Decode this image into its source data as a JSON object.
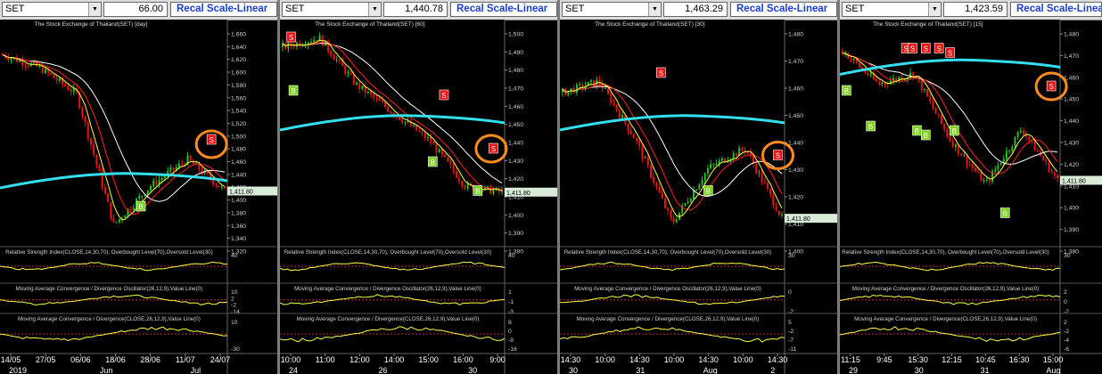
{
  "panels": [
    {
      "symbol": "SET",
      "value": "66.00",
      "recal": "Recal Scale-Linear",
      "title": "The Stock Exchange of Thailand(SET) [day]",
      "price_ticks": [
        "1,660",
        "1,640",
        "1,620",
        "1,600",
        "1,580",
        "1,560",
        "1,540",
        "1,520",
        "1,500",
        "1,480",
        "1,460",
        "1,440",
        "1,420",
        "1,400",
        "1,380",
        "1,360",
        "1,340",
        "1,320"
      ],
      "last_price": "1,411.80",
      "rsi_title": "Relative Strength Index(CLOSE,14,30,70), Overbought Level(70),Oversold Level(30)",
      "rsi_ticks": [
        "40"
      ],
      "macd1_title": "Moving Average Convergence / Divergence Oscillator(26,12,9),Value Line(0)",
      "macd1_ticks": [
        "10",
        "2",
        "-2",
        "-14"
      ],
      "macd2_title": "Moving Average Convergence / Divergence(CLOSE,26,12,9),Value Line(0)",
      "macd2_ticks": [
        "10",
        "-30"
      ],
      "time_labels": [
        "14/05",
        "27/05",
        "06/06",
        "18/06",
        "28/06",
        "11/07",
        "24/07"
      ],
      "sub_labels": [
        "2019",
        "Jun",
        "Jul"
      ],
      "signals": [
        {
          "t": "S"
        },
        {
          "t": "B"
        }
      ]
    },
    {
      "symbol": "SET",
      "value": "1,440.78",
      "recal": "Recal Scale-Linear",
      "title": "The Stock Exchange of Thailand(SET) [60]",
      "price_ticks": [
        "1,500",
        "1,490",
        "1,480",
        "1,470",
        "1,460",
        "1,450",
        "1,440",
        "1,430",
        "1,420",
        "1,410",
        "1,400",
        "1,390",
        "1,380"
      ],
      "last_price": "1,411.80",
      "rsi_title": "Relative Strength Index(CLOSE,14,30,70), Overbought Level(70),Oversold Level(30)",
      "rsi_ticks": [
        "40"
      ],
      "macd1_title": "Moving Average Convergence / Divergence Oscillator(26,12,9),Value Line(0)",
      "macd1_ticks": [
        "1",
        "-1",
        "-3"
      ],
      "macd2_title": "Moving Average Convergence / Divergence(CLOSE,26,12,9),Value Line(0)",
      "macd2_ticks": [
        "8",
        "0",
        "-8",
        "-16"
      ],
      "time_labels": [
        "10:00",
        "11:00",
        "12:00",
        "14:00",
        "15:00",
        "16:00",
        "9:00"
      ],
      "sub_labels": [
        "24",
        "26",
        "30"
      ],
      "signals": [
        {
          "t": "S"
        },
        {
          "t": "B"
        }
      ]
    },
    {
      "symbol": "SET",
      "value": "1,463.29",
      "recal": "Recal Scale-Linear",
      "title": "The Stock Exchange of Thailand(SET) [30]",
      "price_ticks": [
        "1,480",
        "1,470",
        "1,460",
        "1,450",
        "1,440",
        "1,430",
        "1,420",
        "1,410",
        "1,400"
      ],
      "last_price": "1,411.80",
      "rsi_title": "Relative Strength Index(CLOSE,14,30,70), Overbought Level(70),Oversold Level(30)",
      "rsi_ticks": [
        "30"
      ],
      "macd1_title": "Moving Average Convergence / Divergence Oscillator(26,12,9),Value Line(0)",
      "macd1_ticks": [
        "0",
        "-2"
      ],
      "macd2_title": "Moving Average Convergence / Divergence(CLOSE,26,12,9),Value Line(0)",
      "macd2_ticks": [
        "5",
        "-2",
        "-7",
        "-11"
      ],
      "time_labels": [
        "14:30",
        "10:00",
        "14:30",
        "10:00",
        "14:30",
        "10:00",
        "14:30"
      ],
      "sub_labels": [
        "30",
        "31",
        "Aug",
        "2"
      ],
      "signals": [
        {
          "t": "S"
        },
        {
          "t": "B"
        }
      ]
    },
    {
      "symbol": "SET",
      "value": "1,423.59",
      "recal": "Recal Scale-Linear",
      "title": "The Stock Exchange of Thailand(SET) [15]",
      "price_ticks": [
        "1,480",
        "1,470",
        "1,460",
        "1,450",
        "1,440",
        "1,430",
        "1,420",
        "1,410",
        "1,400",
        "1,390",
        "1,380"
      ],
      "last_price": "1,411.80",
      "rsi_title": "Relative Strength Index(CLOSE,14,30,70), Overbought Level(70),Oversold Level(30)",
      "rsi_ticks": [
        "30"
      ],
      "macd1_title": "Moving Average Convergence / Divergence Oscillator(26,12,9),Value Line(0)",
      "macd1_ticks": [
        "2",
        "0",
        "-2"
      ],
      "macd2_title": "Moving Average Convergence / Divergence(CLOSE,26,12,9),Value Line(0)",
      "macd2_ticks": [
        "2",
        "-2",
        "-4",
        "-6"
      ],
      "time_labels": [
        "11:15",
        "9:45",
        "15:30",
        "12:15",
        "10:45",
        "16:30",
        "15:00"
      ],
      "sub_labels": [
        "29",
        "30",
        "31",
        "Aug"
      ],
      "signals": [
        {
          "t": "S"
        },
        {
          "t": "B"
        }
      ]
    }
  ],
  "colors": {
    "up": "#22c322",
    "down": "#ee1111",
    "ma_slow": "#ffffff",
    "ma_mid": "#ff2020",
    "ma_fast": "#ffff40",
    "baseline": "#33e0f0",
    "indicator": "#ffff40",
    "circle": "#ff8a1e",
    "signal_s": "#ee1111",
    "signal_b": "#7ed321"
  },
  "chart_data": [
    {
      "type": "line",
      "title": "The Stock Exchange of Thailand(SET) [day]",
      "ylim": [
        1320,
        1660
      ],
      "x": [
        "14/05",
        "27/05",
        "06/06",
        "18/06",
        "28/06",
        "11/07",
        "24/07"
      ],
      "series": [
        {
          "values": [
            1620,
            1600,
            1560,
            1360,
            1420,
            1460,
            1411.8
          ]
        }
      ]
    },
    {
      "type": "line",
      "title": "The Stock Exchange of Thailand(SET) [60]",
      "ylim": [
        1380,
        1500
      ],
      "x": [
        "10:00",
        "11:00",
        "12:00",
        "14:00",
        "15:00",
        "16:00",
        "9:00"
      ],
      "series": [
        {
          "values": [
            1490,
            1495,
            1470,
            1455,
            1440,
            1415,
            1411.8
          ]
        }
      ]
    },
    {
      "type": "line",
      "title": "The Stock Exchange of Thailand(SET) [30]",
      "ylim": [
        1400,
        1480
      ],
      "x": [
        "14:30",
        "10:00",
        "14:30",
        "10:00",
        "14:30",
        "10:00",
        "14:30"
      ],
      "series": [
        {
          "values": [
            1457,
            1461,
            1440,
            1410,
            1430,
            1437,
            1411.8
          ]
        }
      ]
    },
    {
      "type": "line",
      "title": "The Stock Exchange of Thailand(SET) [15]",
      "ylim": [
        1380,
        1480
      ],
      "x": [
        "11:15",
        "9:45",
        "15:30",
        "12:15",
        "10:45",
        "16:30",
        "15:00"
      ],
      "series": [
        {
          "values": [
            1470,
            1455,
            1460,
            1430,
            1410,
            1435,
            1411.8
          ]
        }
      ]
    }
  ]
}
